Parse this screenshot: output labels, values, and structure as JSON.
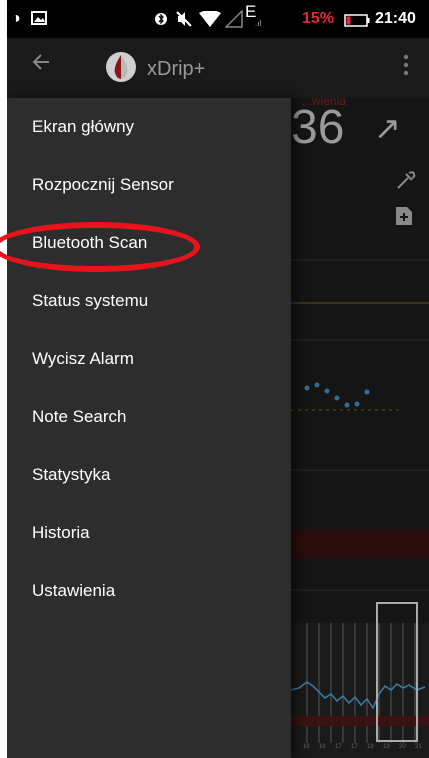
{
  "status_bar": {
    "battery_percent": "15%",
    "time": "21:40",
    "network": "E",
    "battery_color": "#e4283a",
    "icons": [
      "sim-icon",
      "image-icon",
      "bluetooth-icon",
      "mute-icon",
      "wifi-icon",
      "signal-icon",
      "battery-icon"
    ]
  },
  "app_bar": {
    "title": "xDrip+",
    "icons": [
      "back-arrow-icon",
      "xdrip-logo-icon",
      "overflow-menu-icon"
    ]
  },
  "background": {
    "glucose_value": "36",
    "trend_arrow": "↗",
    "warning_text": "...wienia",
    "x_ticks": [
      "16",
      "16",
      "17",
      "17",
      "18",
      "19",
      "20",
      "21"
    ]
  },
  "drawer": {
    "items": [
      {
        "label": "Ekran główny"
      },
      {
        "label": "Rozpocznij Sensor"
      },
      {
        "label": "Bluetooth Scan"
      },
      {
        "label": "Status systemu"
      },
      {
        "label": "Wycisz Alarm"
      },
      {
        "label": "Note Search"
      },
      {
        "label": "Statystyka"
      },
      {
        "label": "Historia"
      },
      {
        "label": "Ustawienia"
      }
    ],
    "highlighted_item": "Bluetooth Scan",
    "highlight_color": "#e8141b"
  }
}
